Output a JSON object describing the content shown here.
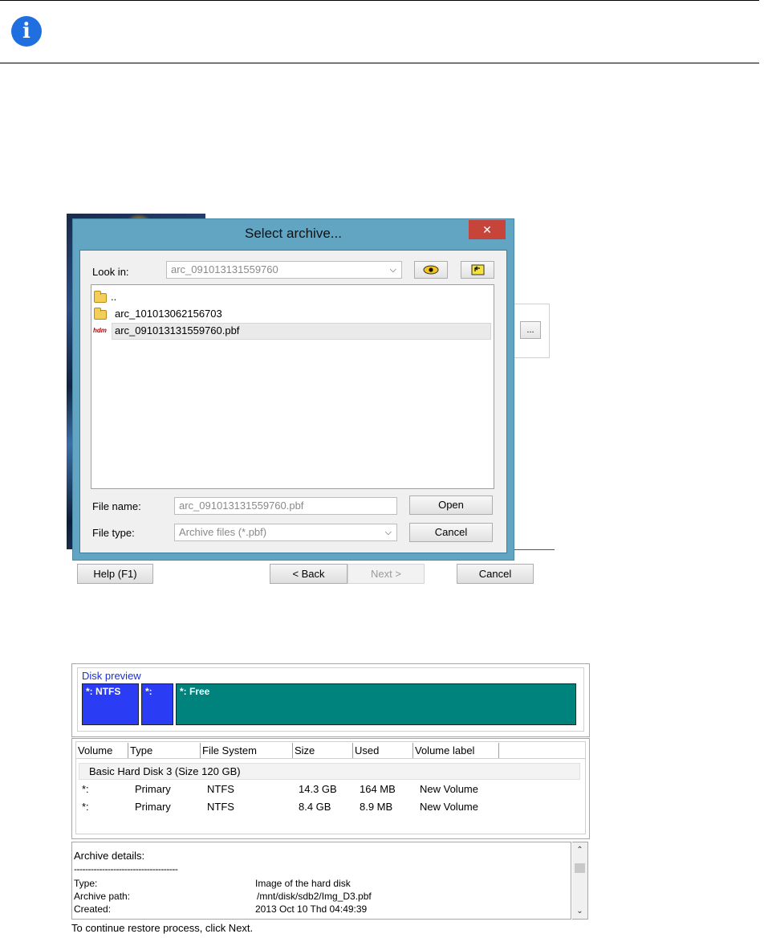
{
  "dialog": {
    "title": "Select archive...",
    "close_glyph": "✕",
    "look_in_label": "Look in:",
    "look_in_value": "arc_091013131559760",
    "files": [
      {
        "name": "..",
        "type": "folder"
      },
      {
        "name": "arc_101013062156703",
        "type": "folder"
      },
      {
        "name": "arc_091013131559760.pbf",
        "type": "archive",
        "icon_text": "hdm"
      }
    ],
    "file_name_label": "File name:",
    "file_name_value": "arc_091013131559760.pbf",
    "file_type_label": "File type:",
    "file_type_value": "Archive files (*.pbf)",
    "open_label": "Open",
    "cancel_label": "Cancel"
  },
  "wizard": {
    "browse_label": "...",
    "help_label": "Help (F1)",
    "back_label": "< Back",
    "next_label": "Next >",
    "cancel_label": "Cancel"
  },
  "disk_preview": {
    "title": "Disk preview",
    "partitions": [
      {
        "label": "*: NTFS",
        "color": "#2a3df5"
      },
      {
        "label": "*:",
        "color": "#2a3df5"
      },
      {
        "label": "*: Free",
        "color": "#00837d"
      }
    ]
  },
  "volumes": {
    "columns": [
      "Volume",
      "Type",
      "File System",
      "Size",
      "Used",
      "Volume label"
    ],
    "group": "Basic Hard Disk 3 (Size 120 GB)",
    "rows": [
      {
        "volume": "*:",
        "type": "Primary",
        "fs": "NTFS",
        "size": "14.3 GB",
        "used": "164 MB",
        "label": "New Volume"
      },
      {
        "volume": "*:",
        "type": "Primary",
        "fs": "NTFS",
        "size": "8.4 GB",
        "used": "8.9 MB",
        "label": "New Volume"
      }
    ]
  },
  "details": {
    "title": "Archive details:",
    "separator": "-------------------------------------",
    "items": [
      {
        "key": "Type:",
        "value": "Image of the hard disk"
      },
      {
        "key": "Archive path:",
        "value": "/mnt/disk/sdb2/Img_D3.pbf"
      },
      {
        "key": "Created:",
        "value": "2013 Oct 10 Thd 04:49:39"
      }
    ]
  },
  "footer_text": "To continue restore process, click Next.",
  "colors": {
    "info_icon": "#1f6fe0",
    "dialog_frame": "#61a5c3",
    "close_button": "#c7443a"
  }
}
